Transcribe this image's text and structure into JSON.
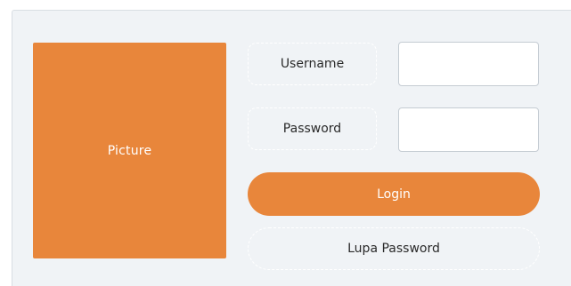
{
  "picture": {
    "label": "Picture",
    "color": "#e8863b"
  },
  "form": {
    "username_label": "Username",
    "password_label": "Password",
    "username_value": "",
    "password_value": "",
    "login_label": "Login",
    "forgot_label": "Lupa Password"
  },
  "colors": {
    "accent": "#e8863b",
    "panel_background": "#f0f3f6"
  }
}
